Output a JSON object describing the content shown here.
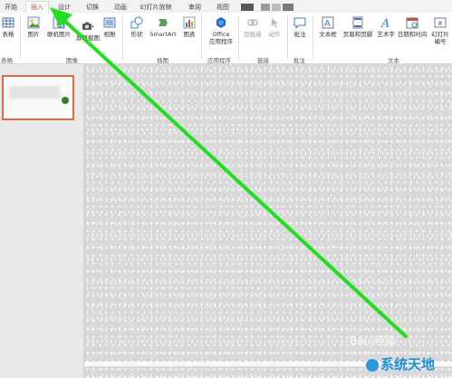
{
  "tabs": [
    {
      "label": "开始",
      "active": false
    },
    {
      "label": "插入",
      "active": true
    },
    {
      "label": "设计",
      "active": false
    },
    {
      "label": "切换",
      "active": false
    },
    {
      "label": "动画",
      "active": false
    },
    {
      "label": "幻灯片放映",
      "active": false
    },
    {
      "label": "审阅",
      "active": false
    },
    {
      "label": "视图",
      "active": false
    }
  ],
  "ribbon": {
    "buttons": {
      "table": "表格",
      "picture": "图片",
      "online_picture": "联机图片",
      "screenshot": "屏幕截图",
      "album": "相册",
      "shapes": "形状",
      "smartart": "SmartArt",
      "chart": "图表",
      "office_apps_line1": "Office",
      "office_apps_line2": "应用程序",
      "hyperlink": "超链接",
      "action": "动作",
      "comment": "批注",
      "textbox": "文本框",
      "header_footer": "页眉和页脚",
      "wordart": "艺术字",
      "date_time": "日期和时间",
      "slide_number_line1": "幻灯片",
      "slide_number_line2": "编号"
    },
    "groups": {
      "table": "表格",
      "images": "图像",
      "illustrations": "插图",
      "apps": "应用程序",
      "links": "链接",
      "comments": "批注",
      "text": "文本"
    }
  },
  "colors": {
    "accent": "#c0504d",
    "arrow": "#22dd22",
    "thumb_border": "#e2673f"
  },
  "watermark": {
    "brand": "Bai",
    "brand_cn": "经验",
    "site": "系统天地"
  }
}
